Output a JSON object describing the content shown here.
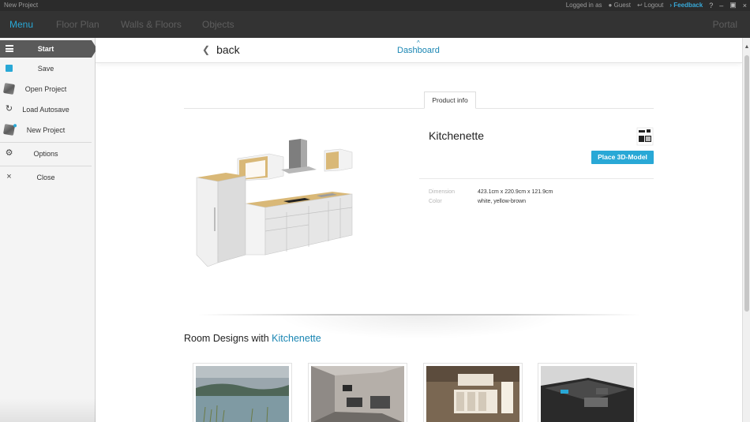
{
  "titlebar": {
    "app_title": "New Project",
    "logged_in_label": "Logged in as",
    "user": "Guest",
    "logout": "Logout",
    "feedback": "Feedback",
    "help": "?",
    "minimize": "–",
    "restore": "▣",
    "close": "×"
  },
  "nav": {
    "tabs": [
      "Menu",
      "Floor Plan",
      "Walls & Floors",
      "Objects"
    ],
    "active": "Menu",
    "portal": "Portal"
  },
  "sidebar": {
    "start_label": "Start",
    "items": [
      {
        "label": "Save",
        "icon": "save-icon"
      },
      {
        "label": "Open Project",
        "icon": "open-project-icon"
      },
      {
        "label": "Load Autosave",
        "icon": "autosave-icon"
      },
      {
        "label": "New Project",
        "icon": "new-project-icon"
      },
      {
        "label": "Options",
        "icon": "gear-icon"
      },
      {
        "label": "Close",
        "icon": "close-icon"
      }
    ]
  },
  "content": {
    "back_label": "back",
    "dashboard_label": "Dashboard",
    "tab_label": "Product info",
    "product_name": "Kitchenette",
    "place_button": "Place 3D-Model",
    "specs": [
      {
        "label": "Dimension",
        "value": "423.1cm x 220.9cm x 121.9cm"
      },
      {
        "label": "Color",
        "value": "white, yellow-brown"
      }
    ],
    "room_designs_prefix": "Room Designs with",
    "room_designs_accent": "Kitchenette"
  },
  "colors": {
    "accent": "#29a8d6",
    "titlebar_bg": "#2b2b2b",
    "navbar_bg": "#333333",
    "sidebar_bg": "#f4f4f4"
  }
}
